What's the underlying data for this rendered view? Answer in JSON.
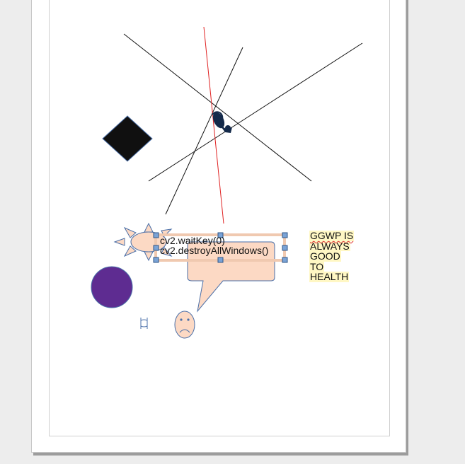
{
  "document": {
    "code_lines": [
      "cv2.waitKey(0)",
      "cv2.destroyAllWindows()"
    ],
    "note_lines": [
      "GGWP IS",
      "ALWAYS",
      "GOOD",
      "TO",
      "HEALTH"
    ]
  },
  "colors": {
    "shape_fill": "#fcd9c4",
    "shape_stroke": "#4a6fa8",
    "circle_fill": "#5e2c91",
    "diamond_fill": "#101010",
    "red_line": "#e02020",
    "note_highlight": "#fff7c4",
    "handle_fill": "#7aa3d6"
  },
  "icons": {
    "sun": "sun-shape-icon",
    "smiley": "sad-face-icon",
    "callout": "speech-callout-shape",
    "figure": "figure-silhouette-icon"
  }
}
